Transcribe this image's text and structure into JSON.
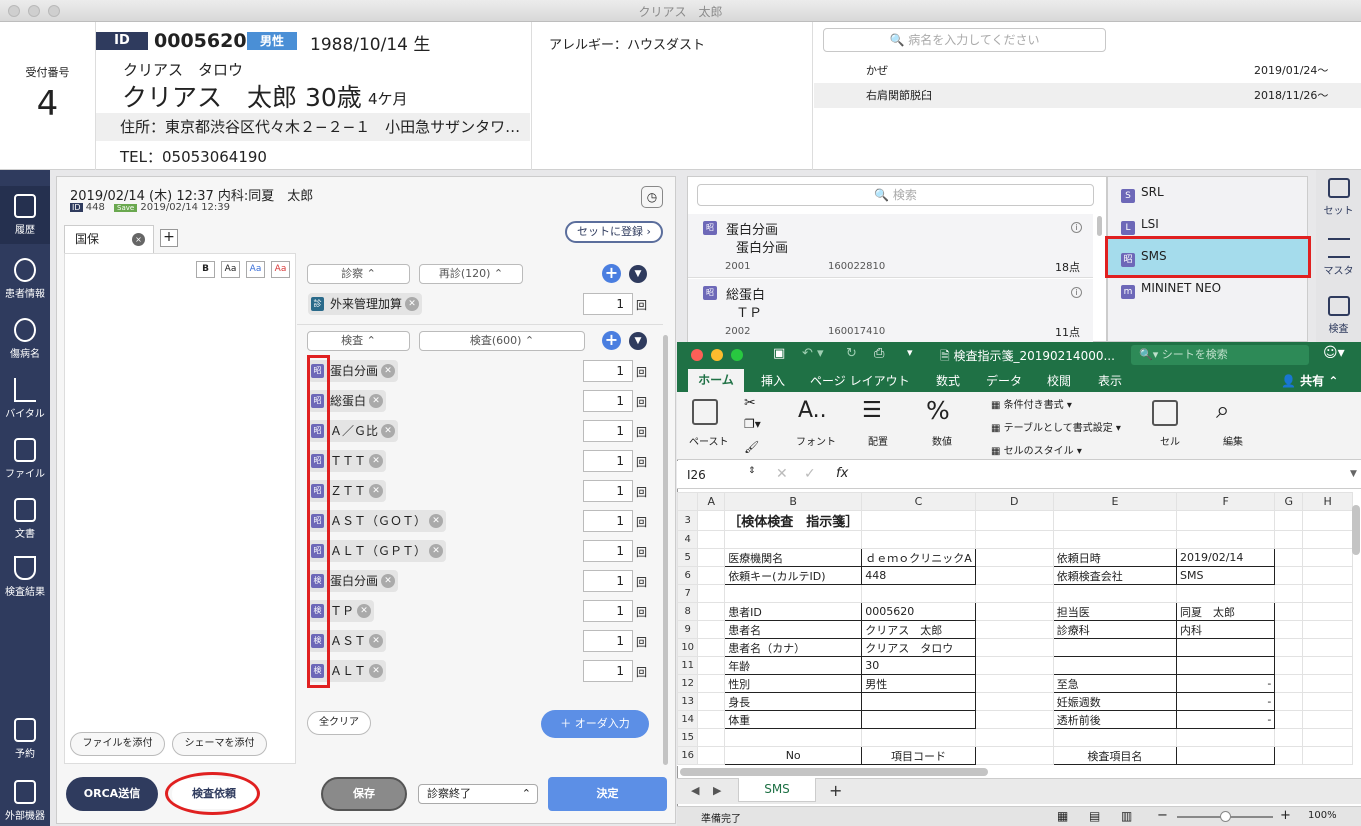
{
  "window": {
    "title": "クリアス　太郎"
  },
  "patient": {
    "reception_label": "受付番号",
    "reception_number": "4",
    "id_label": "ID",
    "id": "0005620",
    "gender": "男性",
    "birth": "1988/10/14 生",
    "kana": "クリアス　タロウ",
    "name_age": "クリアス　太郎 30歳",
    "months": "4ケ月",
    "address": "住所：東京都渋谷区代々木２−２−１　小田急サザンタワ…",
    "tel": "TEL：05053064190",
    "allergy": "アレルギー：ハウスダスト"
  },
  "disease": {
    "search_placeholder": "病名を入力してください",
    "rows": [
      {
        "name": "かぜ",
        "date": "2019/01/24〜"
      },
      {
        "name": "右肩関節脱臼",
        "date": "2018/11/26〜"
      }
    ]
  },
  "sidebar": [
    {
      "label": "履歴",
      "icon": "history-doc-icon"
    },
    {
      "label": "患者情報",
      "icon": "person-icon"
    },
    {
      "label": "傷病名",
      "icon": "injury-icon"
    },
    {
      "label": "バイタル",
      "icon": "chart-line-icon"
    },
    {
      "label": "ファイル",
      "icon": "folder-icon"
    },
    {
      "label": "文書",
      "icon": "document-icon"
    },
    {
      "label": "検査結果",
      "icon": "flask-icon"
    },
    {
      "label": "予約",
      "icon": "calendar-icon"
    },
    {
      "label": "外部機器",
      "icon": "device-icon"
    }
  ],
  "karte": {
    "header": "2019/02/14 (木) 12:37 内科:同夏　太郎",
    "sub_id": "448",
    "sub_save": "Save",
    "sub_date": "2019/02/14 12:39",
    "set_register": "セットに登録",
    "tab": "国保",
    "format_buttons": [
      "B",
      "Aa",
      "Aa",
      "Aa"
    ],
    "attach_file": "ファイルを添付",
    "attach_schema": "シェーマを添付",
    "shinsatsu_select": "診察",
    "saishin_select": "再診(120)",
    "gairai_item": "外来管理加算",
    "gairai_badge": "診",
    "kensa_select": "検査",
    "kensa_sub_select": "検査(600)",
    "qty": "1",
    "kai": "回",
    "exam_items": [
      {
        "badge": "昭",
        "name": "蛋白分画"
      },
      {
        "badge": "昭",
        "name": "総蛋白"
      },
      {
        "badge": "昭",
        "name": "Ａ／Ｇ比"
      },
      {
        "badge": "昭",
        "name": "ＴＴＴ"
      },
      {
        "badge": "昭",
        "name": "ＺＴＴ"
      },
      {
        "badge": "昭",
        "name": "ＡＳＴ（ＧＯＴ）"
      },
      {
        "badge": "昭",
        "name": "ＡＬＴ（ＧＰＴ）"
      },
      {
        "badge": "検",
        "name": "蛋白分画"
      },
      {
        "badge": "検",
        "name": "ＴＰ"
      },
      {
        "badge": "検",
        "name": "ＡＳＴ"
      },
      {
        "badge": "検",
        "name": "ＡＬＴ"
      }
    ],
    "clear_all": "全クリア",
    "order_input": "オーダ入力",
    "orca_send": "ORCA送信",
    "exam_request": "検査依頼",
    "save": "保存",
    "finish_select": "診察終了",
    "decide": "決定"
  },
  "master": {
    "search_placeholder": "検索",
    "rows": [
      {
        "badge": "昭",
        "name": "蛋白分画",
        "sub": "蛋白分画",
        "code1": "2001",
        "code2": "160022810",
        "points": "18点"
      },
      {
        "badge": "昭",
        "name": "総蛋白",
        "sub": "ＴＰ",
        "code1": "2002",
        "code2": "160017410",
        "points": "11点"
      }
    ],
    "labs": [
      {
        "badge": "S",
        "name": "SRL"
      },
      {
        "badge": "L",
        "name": "LSI"
      },
      {
        "badge": "昭",
        "name": "SMS"
      },
      {
        "badge": "m",
        "name": "MININET NEO"
      }
    ],
    "right_bar": [
      {
        "label": "セット",
        "icon": "set-icon"
      },
      {
        "label": "マスタ",
        "icon": "list-icon"
      },
      {
        "label": "検査",
        "icon": "clipboard-icon"
      }
    ]
  },
  "excel": {
    "filename": "検査指示箋_20190214000...",
    "search_placeholder": "シートを検索",
    "share": "共有",
    "tabs": [
      "ホーム",
      "挿入",
      "ページ レイアウト",
      "数式",
      "データ",
      "校閲",
      "表示"
    ],
    "ribbon": {
      "paste": "ペースト",
      "font": "フォント",
      "align": "配置",
      "number": "数値",
      "cond_format": "条件付き書式",
      "table_format": "テーブルとして書式設定",
      "cell_style": "セルのスタイル",
      "cell": "セル",
      "edit": "編集"
    },
    "cell_ref": "I26",
    "fx": "fx",
    "columns": [
      "A",
      "B",
      "C",
      "D",
      "E",
      "F",
      "G",
      "H"
    ],
    "rows": [
      {
        "n": "3",
        "cells": [
          "",
          "［検体検査　指示箋］",
          "",
          "",
          "",
          "",
          "",
          ""
        ]
      },
      {
        "n": "4",
        "cells": [
          "",
          "",
          "",
          "",
          "",
          "",
          "",
          ""
        ]
      },
      {
        "n": "5",
        "cells": [
          "",
          "医療機関名",
          "ｄｅｍｏクリニックA",
          "",
          "依頼日時",
          "2019/02/14",
          "",
          ""
        ]
      },
      {
        "n": "6",
        "cells": [
          "",
          "依頼キー(カルテID)",
          "448",
          "",
          "依頼検査会社",
          "SMS",
          "",
          ""
        ]
      },
      {
        "n": "7",
        "cells": [
          "",
          "",
          "",
          "",
          "",
          "",
          "",
          ""
        ]
      },
      {
        "n": "8",
        "cells": [
          "",
          "患者ID",
          "0005620",
          "",
          "担当医",
          "同夏　太郎",
          "",
          ""
        ]
      },
      {
        "n": "9",
        "cells": [
          "",
          "患者名",
          "クリアス　太郎",
          "",
          "診療科",
          "内科",
          "",
          ""
        ]
      },
      {
        "n": "10",
        "cells": [
          "",
          "患者名（カナ）",
          "クリアス　タロウ",
          "",
          "",
          "",
          "",
          ""
        ]
      },
      {
        "n": "11",
        "cells": [
          "",
          "年齢",
          "30",
          "",
          "",
          "",
          "",
          ""
        ]
      },
      {
        "n": "12",
        "cells": [
          "",
          "性別",
          "男性",
          "",
          "至急",
          "-",
          "",
          ""
        ]
      },
      {
        "n": "13",
        "cells": [
          "",
          "身長",
          "",
          "",
          "妊娠週数",
          "-",
          "",
          ""
        ]
      },
      {
        "n": "14",
        "cells": [
          "",
          "体重",
          "",
          "",
          "透析前後",
          "-",
          "",
          ""
        ]
      },
      {
        "n": "15",
        "cells": [
          "",
          "",
          "",
          "",
          "",
          "",
          "",
          ""
        ]
      },
      {
        "n": "16",
        "cells": [
          "",
          "No",
          "項目コード",
          "",
          "検査項目名",
          "",
          "",
          ""
        ]
      }
    ],
    "sheet_tab": "SMS",
    "status": "準備完了",
    "zoom": "100%"
  }
}
